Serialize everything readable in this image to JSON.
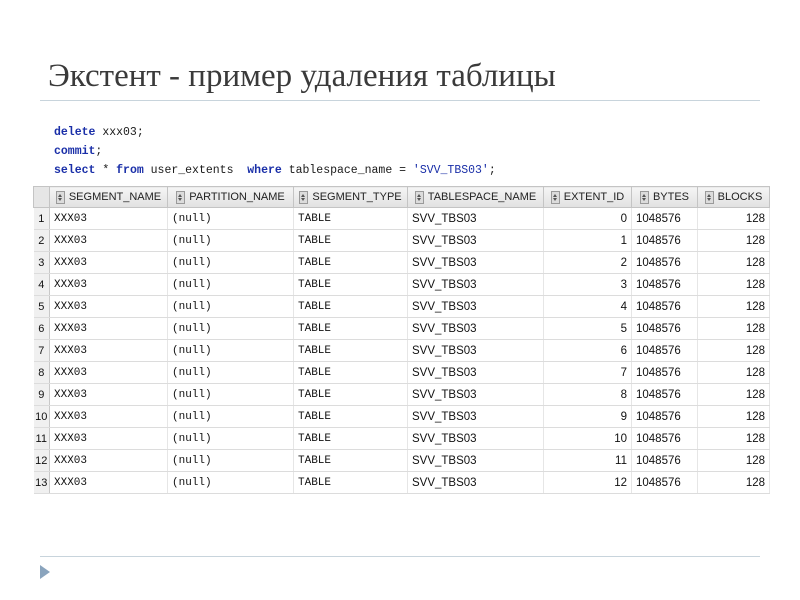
{
  "slide": {
    "title": "Экстент - пример удаления таблицы"
  },
  "sql": {
    "line1_kw": "delete",
    "line1_rest": " xxx03;",
    "line2_kw": "commit",
    "line2_rest": ";",
    "line3_kw1": "select",
    "line3_mid1": " * ",
    "line3_kw2": "from",
    "line3_mid2": " user_extents  ",
    "line3_kw3": "where",
    "line3_mid3": " tablespace_name = ",
    "line3_str": "'SVV_TBS03'",
    "line3_end": ";"
  },
  "grid": {
    "columns": [
      "SEGMENT_NAME",
      "PARTITION_NAME",
      "SEGMENT_TYPE",
      "TABLESPACE_NAME",
      "EXTENT_ID",
      "BYTES",
      "BLOCKS"
    ],
    "rows": [
      {
        "n": "1",
        "seg": "XXX03",
        "part": "(null)",
        "type": "TABLE",
        "ts": "SVV_TBS03",
        "ext": "0",
        "bytes": "1048576",
        "blocks": "128"
      },
      {
        "n": "2",
        "seg": "XXX03",
        "part": "(null)",
        "type": "TABLE",
        "ts": "SVV_TBS03",
        "ext": "1",
        "bytes": "1048576",
        "blocks": "128"
      },
      {
        "n": "3",
        "seg": "XXX03",
        "part": "(null)",
        "type": "TABLE",
        "ts": "SVV_TBS03",
        "ext": "2",
        "bytes": "1048576",
        "blocks": "128"
      },
      {
        "n": "4",
        "seg": "XXX03",
        "part": "(null)",
        "type": "TABLE",
        "ts": "SVV_TBS03",
        "ext": "3",
        "bytes": "1048576",
        "blocks": "128"
      },
      {
        "n": "5",
        "seg": "XXX03",
        "part": "(null)",
        "type": "TABLE",
        "ts": "SVV_TBS03",
        "ext": "4",
        "bytes": "1048576",
        "blocks": "128"
      },
      {
        "n": "6",
        "seg": "XXX03",
        "part": "(null)",
        "type": "TABLE",
        "ts": "SVV_TBS03",
        "ext": "5",
        "bytes": "1048576",
        "blocks": "128"
      },
      {
        "n": "7",
        "seg": "XXX03",
        "part": "(null)",
        "type": "TABLE",
        "ts": "SVV_TBS03",
        "ext": "6",
        "bytes": "1048576",
        "blocks": "128"
      },
      {
        "n": "8",
        "seg": "XXX03",
        "part": "(null)",
        "type": "TABLE",
        "ts": "SVV_TBS03",
        "ext": "7",
        "bytes": "1048576",
        "blocks": "128"
      },
      {
        "n": "9",
        "seg": "XXX03",
        "part": "(null)",
        "type": "TABLE",
        "ts": "SVV_TBS03",
        "ext": "8",
        "bytes": "1048576",
        "blocks": "128"
      },
      {
        "n": "10",
        "seg": "XXX03",
        "part": "(null)",
        "type": "TABLE",
        "ts": "SVV_TBS03",
        "ext": "9",
        "bytes": "1048576",
        "blocks": "128"
      },
      {
        "n": "11",
        "seg": "XXX03",
        "part": "(null)",
        "type": "TABLE",
        "ts": "SVV_TBS03",
        "ext": "10",
        "bytes": "1048576",
        "blocks": "128"
      },
      {
        "n": "12",
        "seg": "XXX03",
        "part": "(null)",
        "type": "TABLE",
        "ts": "SVV_TBS03",
        "ext": "11",
        "bytes": "1048576",
        "blocks": "128"
      },
      {
        "n": "13",
        "seg": "XXX03",
        "part": "(null)",
        "type": "TABLE",
        "ts": "SVV_TBS03",
        "ext": "12",
        "bytes": "1048576",
        "blocks": "128"
      }
    ]
  },
  "colors": {
    "keyword": "#1a2fa8",
    "rule": "#c8d4dc",
    "bullet": "#8aa4bd"
  },
  "icons": {
    "column_header": "sort-icon",
    "footer_bullet": "triangle-bullet-icon"
  }
}
